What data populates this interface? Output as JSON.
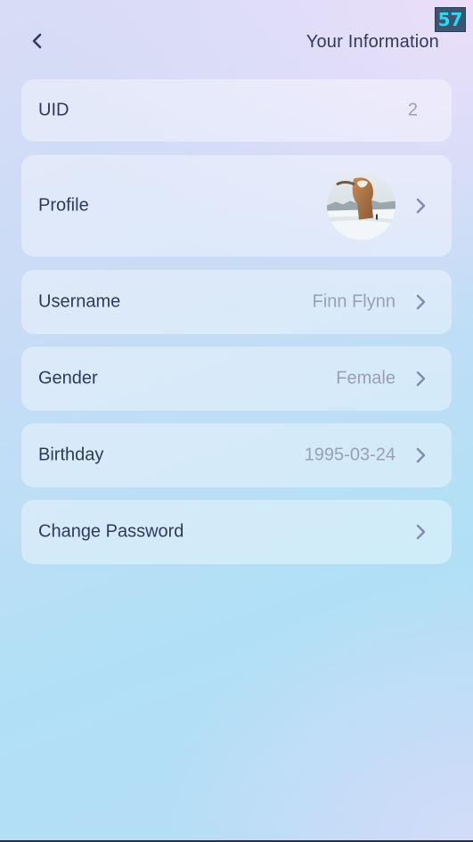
{
  "status": {
    "badge": "57"
  },
  "header": {
    "title": "Your Information",
    "back_icon": "chevron-left-icon"
  },
  "rows": [
    {
      "label": "UID",
      "value": "2",
      "chevron": false
    },
    {
      "label": "Profile",
      "value": "",
      "avatar": "profile-photo-snow-figure",
      "chevron": true
    },
    {
      "label": "Username",
      "value": "Finn Flynn",
      "chevron": true
    },
    {
      "label": "Gender",
      "value": "Female",
      "chevron": true
    },
    {
      "label": "Birthday",
      "value": "1995-03-24",
      "chevron": true
    },
    {
      "label": "Change Password",
      "value": "",
      "chevron": true
    }
  ],
  "colors": {
    "text_primary": "#2e3960",
    "text_secondary": "#9aa0b4",
    "chevron": "#7f8bb0",
    "badge_text": "#2fd6ff"
  }
}
